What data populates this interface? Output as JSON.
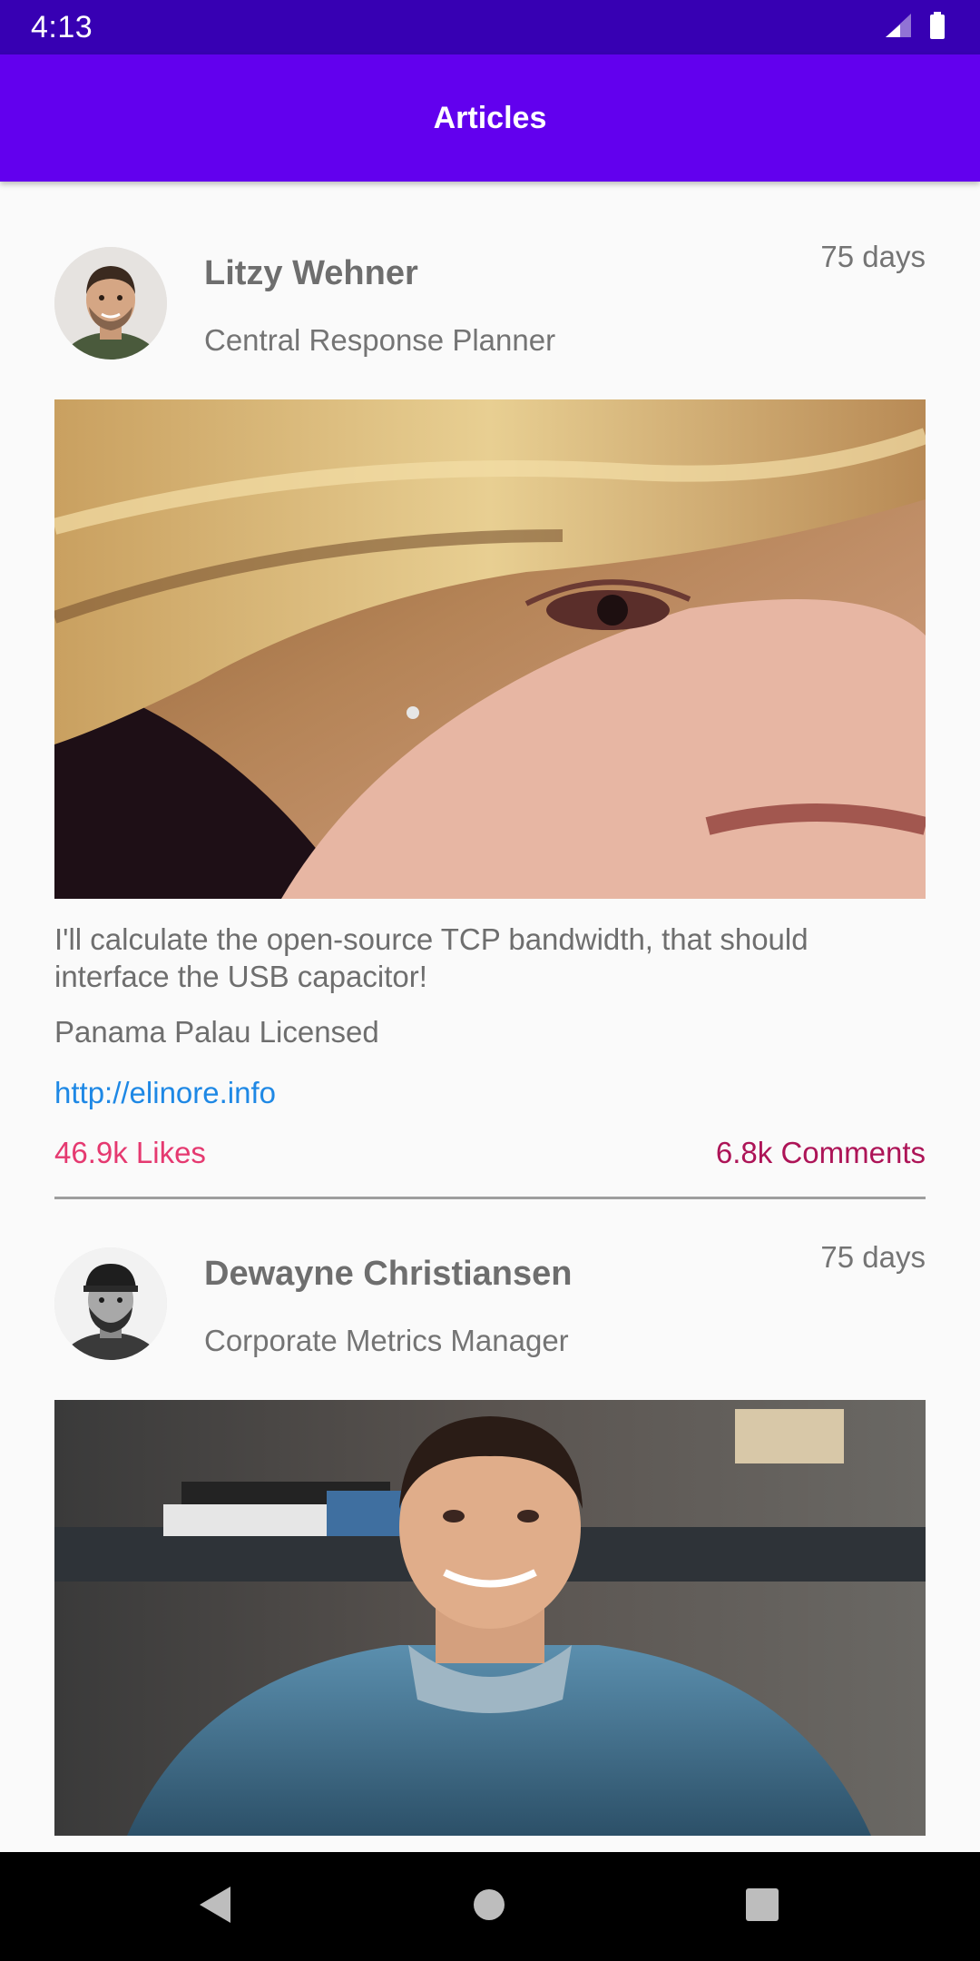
{
  "status_bar": {
    "time": "4:13",
    "icons": [
      "signal-icon",
      "battery-icon"
    ]
  },
  "app_bar": {
    "title": "Articles"
  },
  "posts": [
    {
      "author": "Litzy Wehner",
      "role": "Central Response Planner",
      "age": "75 days",
      "text": "I'll calculate the open-source TCP bandwidth, that should interface the USB capacitor!",
      "tags": "Panama Palau Licensed",
      "link": "http://elinore.info",
      "likes": "46.9k Likes",
      "comments": "6.8k Comments"
    },
    {
      "author": "Dewayne Christiansen",
      "role": "Corporate Metrics Manager",
      "age": "75 days"
    }
  ],
  "nav_bar": {
    "buttons": [
      "back-icon",
      "home-icon",
      "recents-icon"
    ]
  },
  "colors": {
    "status_bar": "#3700b3",
    "app_bar": "#6200ee",
    "background": "#fafafa",
    "link": "#1e88e5",
    "likes": "#e53970",
    "comments": "#ad1457"
  }
}
